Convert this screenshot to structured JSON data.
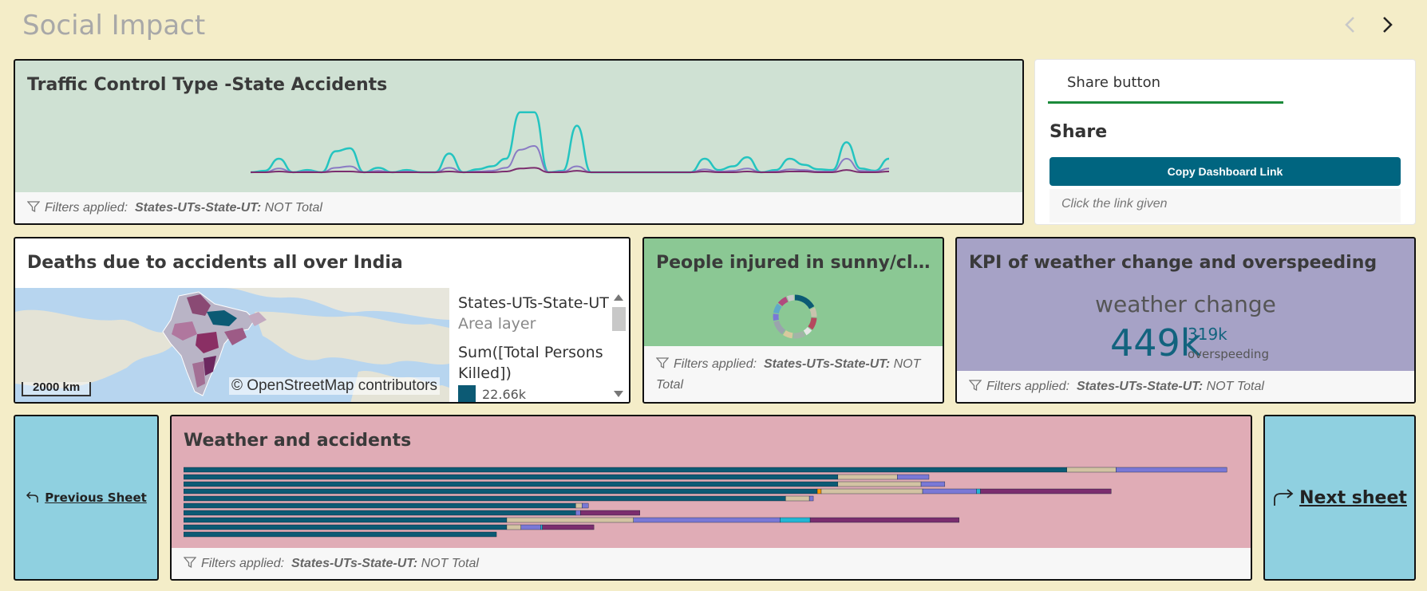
{
  "sheet": {
    "title": "Social Impact"
  },
  "filter": {
    "prefix": "Filters applied:",
    "field": "States-UTs-State-UT:",
    "value": "NOT Total"
  },
  "traffic": {
    "title": "Traffic Control Type -State Accidents"
  },
  "share": {
    "tab_label": "Share button",
    "heading": "Share",
    "copy_button": "Copy Dashboard Link",
    "hint": "Click the link given"
  },
  "deaths": {
    "title": "Deaths due to accidents all over India",
    "scale_label": "2000 km",
    "attribution": "© OpenStreetMap contributors",
    "legend": {
      "field": "States-UTs-State-UT",
      "layer": "Area layer",
      "measure": "Sum([Total Persons Killed])",
      "first_value": "22.66k"
    }
  },
  "injured": {
    "title": "People injured in sunny/clear …"
  },
  "kpi": {
    "title": "KPI of weather change and overspeeding",
    "label": "weather change",
    "main_value": "449k",
    "secondary_value": "319k",
    "secondary_label": "overspeeding"
  },
  "nav": {
    "previous_label": "Previous Sheet",
    "next_label": "Next sheet"
  },
  "weather": {
    "title": "Weather and accidents"
  },
  "colors": {
    "teal": "#24c4c0",
    "purple": "#8a7bc4",
    "plum": "#7b2d6e",
    "navy": "#0c5a74",
    "tan": "#d3c3a3",
    "lavender": "#7a78d6",
    "cyan": "#23b7d4"
  },
  "chart_data": [
    {
      "type": "line",
      "series": [
        {
          "values": [
            0,
            2,
            18,
            0,
            3,
            0,
            28,
            32,
            0,
            6,
            0,
            3,
            0,
            0,
            25,
            0,
            4,
            8,
            18,
            80,
            80,
            0,
            2,
            62,
            0,
            0,
            0,
            0,
            0,
            0,
            0,
            0,
            18,
            3,
            8,
            20,
            0,
            3,
            18,
            10,
            4,
            3,
            40,
            5,
            2,
            18
          ]
        },
        {
          "values": [
            0,
            0,
            5,
            0,
            1,
            0,
            6,
            8,
            0,
            2,
            0,
            1,
            0,
            0,
            6,
            0,
            1,
            2,
            6,
            30,
            35,
            0,
            1,
            8,
            0,
            0,
            0,
            0,
            0,
            0,
            0,
            0,
            4,
            1,
            2,
            5,
            0,
            1,
            4,
            3,
            1,
            1,
            18,
            2,
            1,
            5
          ]
        },
        {
          "values": [
            0,
            0,
            1,
            0,
            0,
            0,
            1,
            1,
            0,
            0,
            0,
            0,
            0,
            0,
            1,
            0,
            0,
            0,
            1,
            5,
            6,
            0,
            0,
            2,
            0,
            0,
            0,
            0,
            0,
            0,
            0,
            0,
            1,
            0,
            0,
            1,
            0,
            0,
            1,
            1,
            0,
            0,
            3,
            0,
            0,
            1
          ]
        }
      ],
      "ylim": [
        0,
        85
      ]
    },
    {
      "type": "pie",
      "series": [
        {
          "values": [
            18,
            8,
            10,
            6,
            10,
            8,
            12,
            6,
            8,
            8,
            6
          ]
        }
      ]
    },
    {
      "type": "bar",
      "orientation": "horizontal",
      "series": [
        {
          "values": [
            1115,
            826,
            826,
            800,
            760,
            495,
            495,
            408,
            408,
            395
          ]
        },
        {
          "values": [
            0,
            0,
            0,
            5,
            0,
            0,
            0,
            0,
            0,
            0
          ]
        },
        {
          "values": [
            62,
            75,
            105,
            128,
            30,
            8,
            0,
            160,
            18,
            0
          ]
        },
        {
          "values": [
            140,
            40,
            30,
            68,
            5,
            8,
            6,
            185,
            25,
            0
          ]
        },
        {
          "values": [
            0,
            0,
            0,
            5,
            0,
            0,
            0,
            38,
            2,
            0
          ]
        },
        {
          "values": [
            0,
            0,
            0,
            165,
            0,
            0,
            75,
            188,
            65,
            0
          ]
        }
      ]
    }
  ]
}
